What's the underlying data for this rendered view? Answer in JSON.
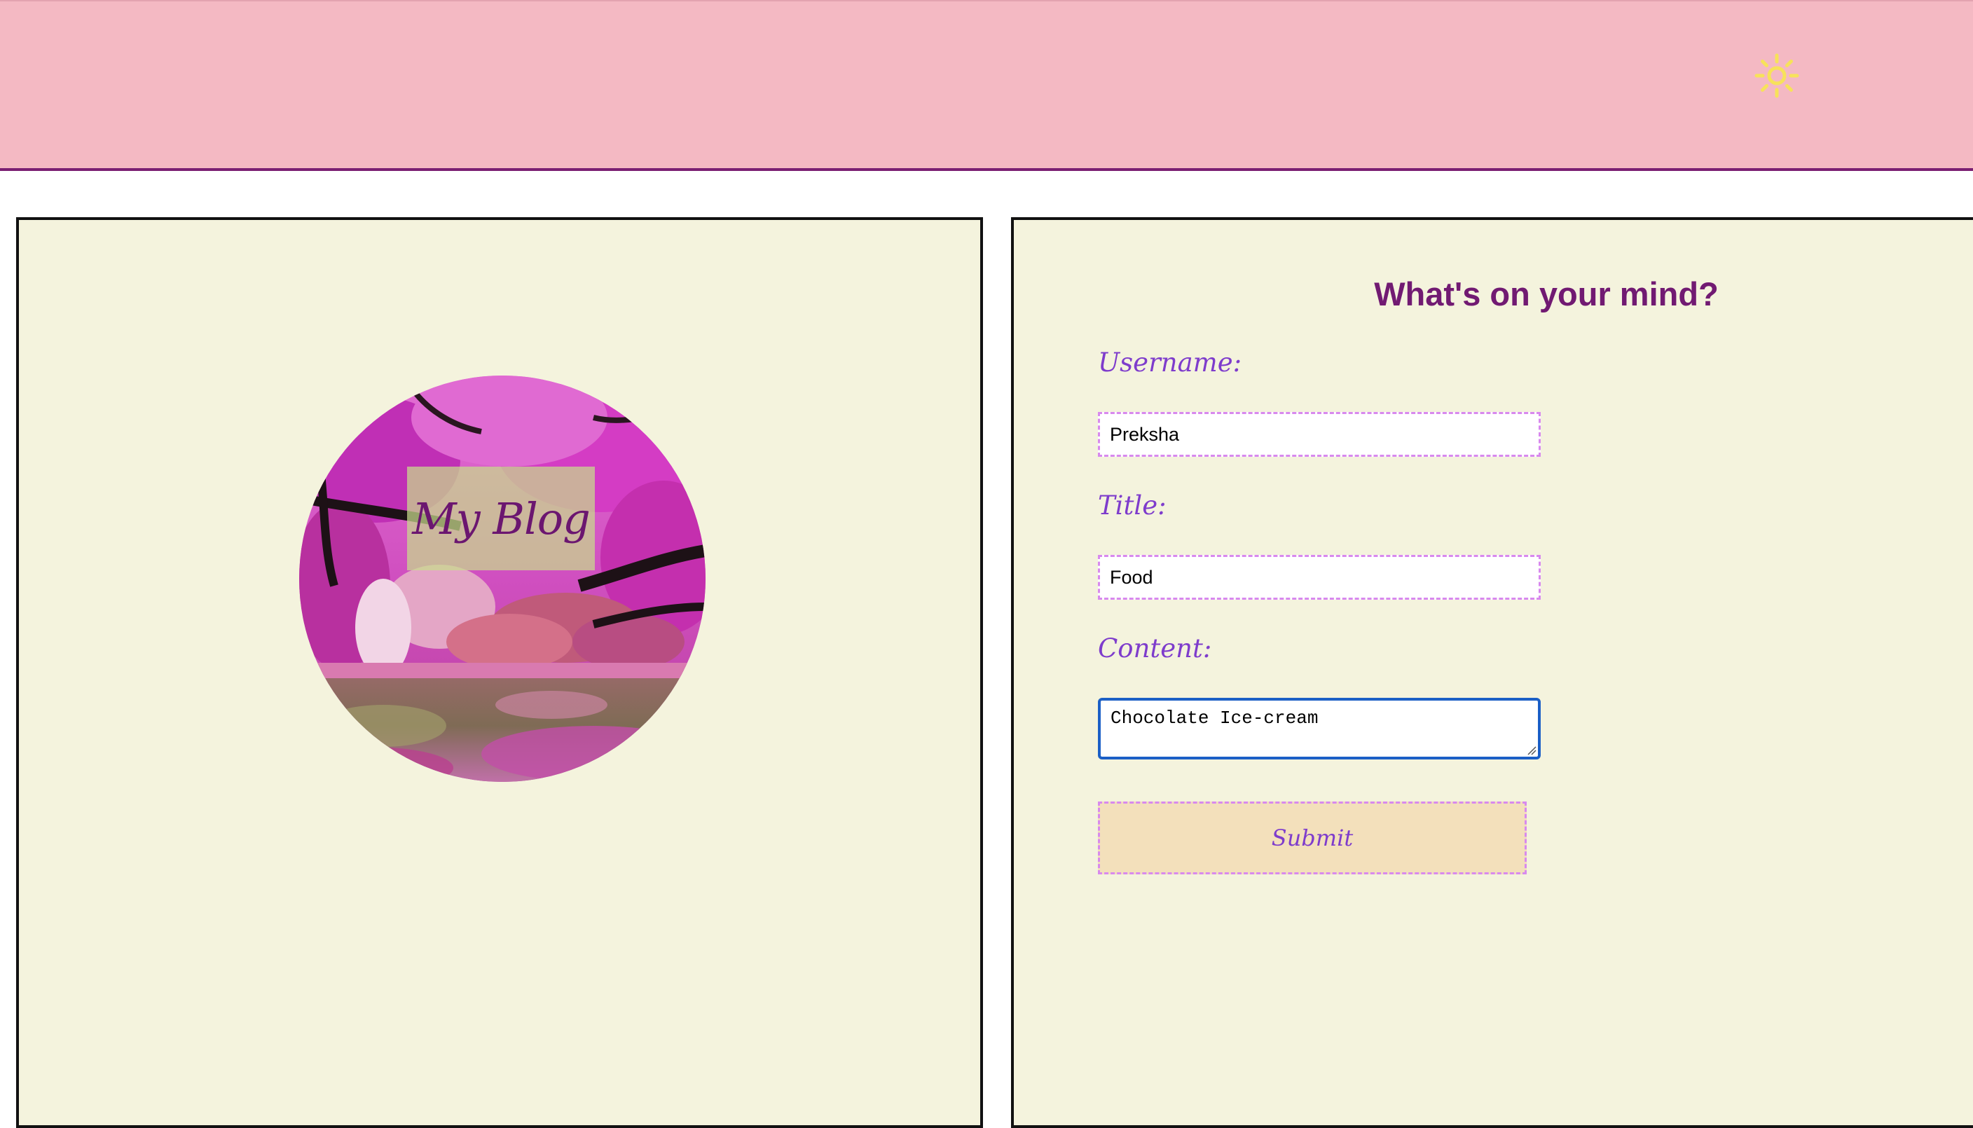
{
  "header": {
    "theme_toggle_icon": "sun-icon",
    "background": "#f4b9c3",
    "border_color": "#7a1f72"
  },
  "blog_logo": {
    "text": "My Blog",
    "image": "pink-blossom-lake-landscape"
  },
  "form": {
    "heading": "What's on your mind?",
    "username_label": "Username:",
    "username_value": "Preksha",
    "title_label": "Title:",
    "title_value": "Food",
    "content_label": "Content:",
    "content_value": "Chocolate Ice-cream",
    "submit_label": "Submit"
  },
  "colors": {
    "panel_background": "#f4f3dd",
    "heading": "#711a72",
    "label": "#7e3ccc",
    "input_border": "#d889ee",
    "focus_border": "#1b5fc6",
    "button_background": "#f3e0bb",
    "sun": "#f7e25a"
  }
}
